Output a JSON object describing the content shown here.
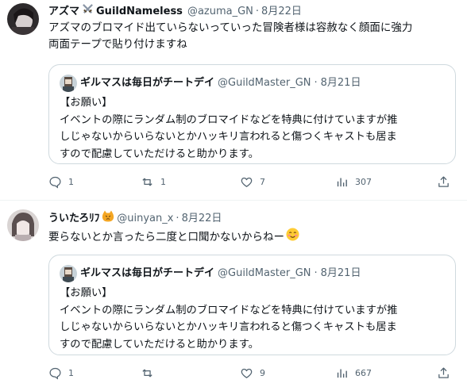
{
  "tweets": [
    {
      "display_name": "アズマ",
      "display_name_suffix": "GuildNameless",
      "handle": "@azuma_GN",
      "sep": "·",
      "date": "8月22日",
      "text_lines": [
        "アズマのブロマイド出ていらないっていった冒険者様は容赦なく顔面に強力",
        "両面テープで貼り付けますね"
      ],
      "quote": {
        "display_name": "ギルマスは毎日がチートデイ",
        "handle": "@GuildMaster_GN",
        "sep": "·",
        "date": "8月21日",
        "text_lines": [
          "【お願い】",
          "イベントの際にランダム制のブロマイドなどを特典に付けていますが推",
          "しじゃないからいらないとかハッキリ言われると傷つくキャストも居ま",
          "すので配慮していただけると助かります。"
        ]
      },
      "actions": {
        "reply": "1",
        "retweet": "1",
        "like": "7",
        "views": "307"
      }
    },
    {
      "display_name": "ういたろﾘﾌ",
      "handle": "@uinyan_x",
      "sep": "·",
      "date": "8月22日",
      "text_lines": [
        "要らないとか言ったら二度と口聞かないからねー"
      ],
      "quote": {
        "display_name": "ギルマスは毎日がチートデイ",
        "handle": "@GuildMaster_GN",
        "sep": "·",
        "date": "8月21日",
        "text_lines": [
          "【お願い】",
          "イベントの際にランダム制のブロマイドなどを特典に付けていますが推",
          "しじゃないからいらないとかハッキリ言われると傷つくキャストも居ま",
          "すので配慮していただけると助かります。"
        ]
      },
      "actions": {
        "reply": "1",
        "retweet": "",
        "like": "9",
        "views": "667"
      }
    }
  ],
  "colors": {
    "text": "#0f1419",
    "secondary": "#536471",
    "border": "#cfd9de",
    "divider": "#eff3f4"
  }
}
